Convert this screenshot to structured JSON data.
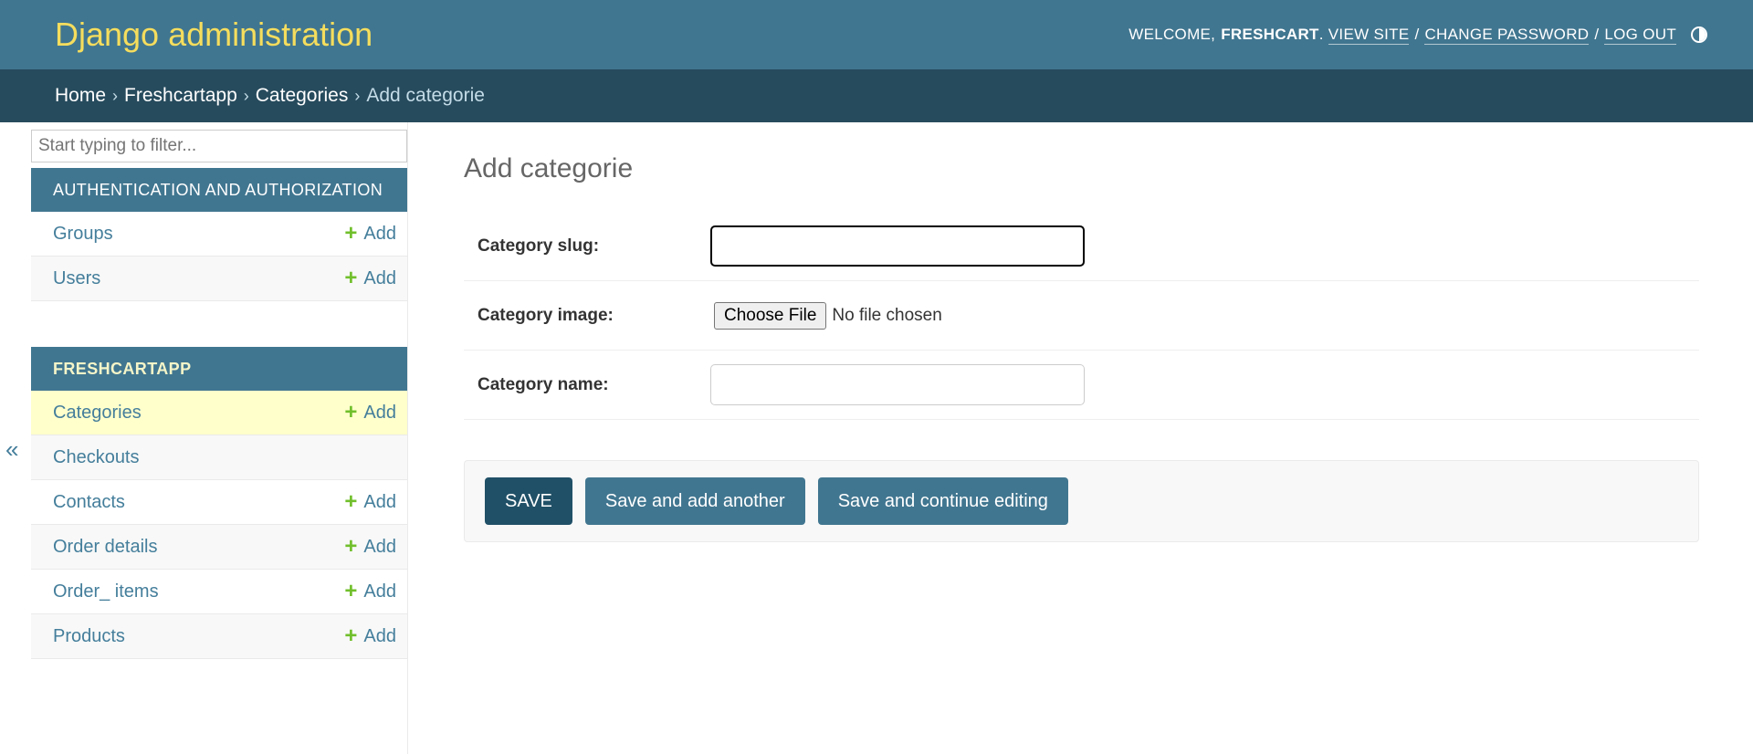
{
  "header": {
    "branding": "Django administration",
    "welcome": "WELCOME,",
    "username": "FRESHCART",
    "view_site": "VIEW SITE",
    "change_password": "CHANGE PASSWORD",
    "log_out": "LOG OUT",
    "sep": "/",
    "theme_icon": "half-circle-contrast-icon"
  },
  "breadcrumbs": {
    "home": "Home",
    "app": "Freshcartapp",
    "model": "Categories",
    "current": "Add categorie",
    "separator": "›"
  },
  "sidebar": {
    "toggle": "«",
    "filter_placeholder": "Start typing to filter...",
    "modules": [
      {
        "caption": "AUTHENTICATION AND AUTHORIZATION",
        "models": [
          {
            "name": "Groups",
            "add": "Add"
          },
          {
            "name": "Users",
            "add": "Add"
          }
        ]
      },
      {
        "caption": "FRESHCARTAPP",
        "models": [
          {
            "name": "Categories",
            "add": "Add"
          },
          {
            "name": "Checkouts"
          },
          {
            "name": "Contacts",
            "add": "Add"
          },
          {
            "name": "Order details",
            "add": "Add"
          },
          {
            "name": "Order_ items",
            "add": "Add"
          },
          {
            "name": "Products",
            "add": "Add"
          }
        ]
      }
    ]
  },
  "form": {
    "title": "Add categorie",
    "fields": {
      "slug": {
        "label": "Category slug:",
        "value": ""
      },
      "image": {
        "label": "Category image:",
        "button": "Choose File",
        "status": "No file chosen"
      },
      "name": {
        "label": "Category name:",
        "value": ""
      }
    },
    "buttons": {
      "save": "SAVE",
      "save_add_another": "Save and add another",
      "save_continue": "Save and continue editing"
    }
  },
  "colors": {
    "header": "#417690",
    "breadcrumbs": "#264b5d",
    "branding": "#f5dd5d",
    "link": "#447e9b",
    "add_plus": "#70bf2b",
    "current_row": "#ffffcc",
    "save_button": "#205067"
  }
}
